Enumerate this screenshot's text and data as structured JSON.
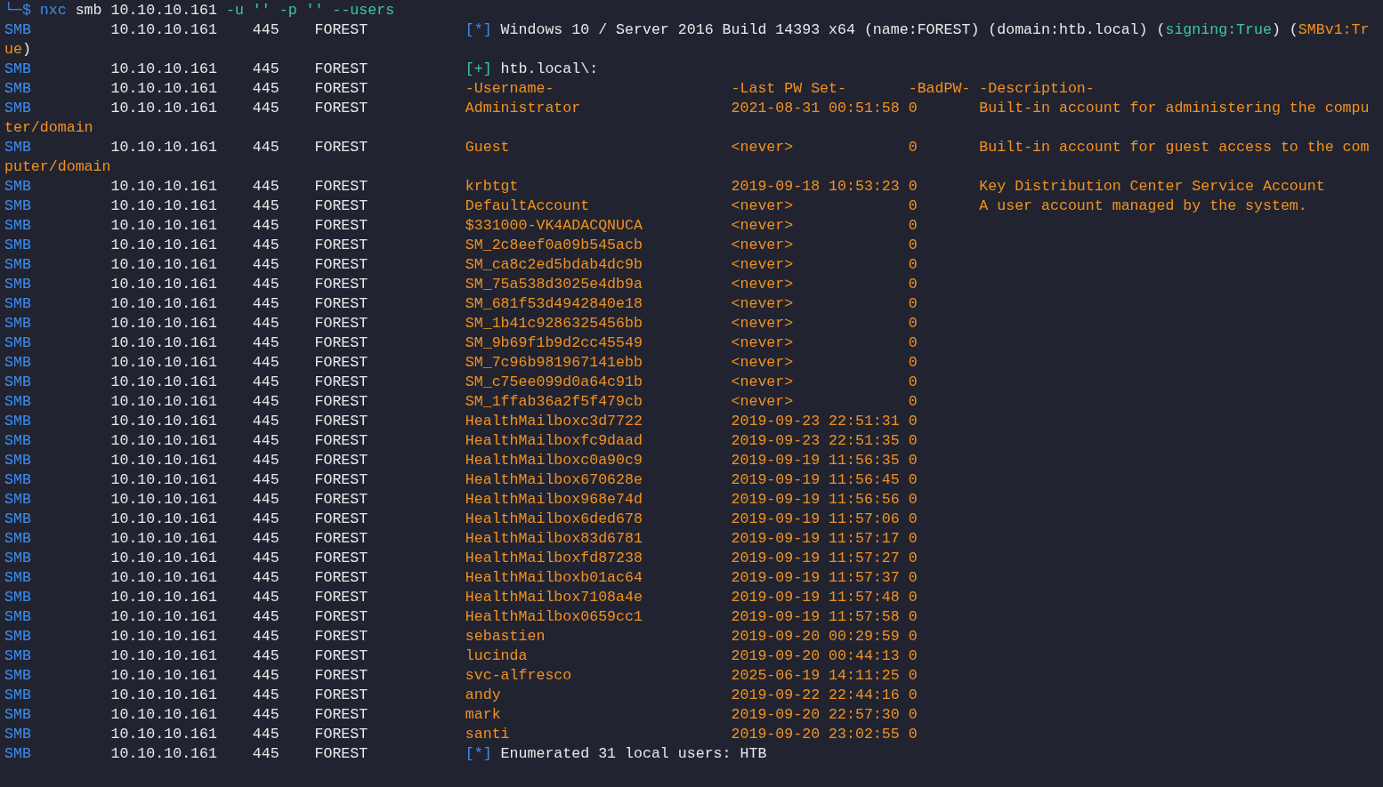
{
  "prompt": {
    "symbol": "└─$",
    "command": "nxc",
    "arguments": "smb 10.10.10.161",
    "options": "-u '' -p '' --users"
  },
  "lines": [
    {
      "kind": "smb",
      "protocol": "SMB",
      "host": "10.10.10.161",
      "port": "445",
      "name": "FOREST",
      "message": {
        "kind": "status",
        "marker": "[*]",
        "segments": [
          {
            "text": "Windows 10 / Server 2016 Build 14393 x64 (name:FOREST) (domain:htb.local) (",
            "kind": "plain"
          },
          {
            "text": "signing:True",
            "kind": "good"
          },
          {
            "text": ") (",
            "kind": "plain"
          },
          {
            "text": "SMBv1:Tr",
            "kind": "warn"
          }
        ]
      }
    },
    {
      "kind": "wrap",
      "segments": [
        {
          "text": "ue",
          "kind": "warn"
        },
        {
          "text": ")",
          "kind": "plain"
        }
      ]
    },
    {
      "kind": "smb",
      "protocol": "SMB",
      "host": "10.10.10.161",
      "port": "445",
      "name": "FOREST",
      "message": {
        "kind": "success",
        "marker": "[+]",
        "segments": [
          {
            "text": "htb.local\\:",
            "kind": "plain"
          }
        ]
      }
    },
    {
      "kind": "smb",
      "protocol": "SMB",
      "host": "10.10.10.161",
      "port": "445",
      "name": "FOREST",
      "message": {
        "kind": "header",
        "username": "-Username-",
        "last_pw_set": "-Last PW Set-",
        "bad_pw": "-BadPW-",
        "description": "-Description-"
      }
    },
    {
      "kind": "smb",
      "protocol": "SMB",
      "host": "10.10.10.161",
      "port": "445",
      "name": "FOREST",
      "message": {
        "kind": "user",
        "username": "Administrator",
        "last_pw_set": "2021-08-31 00:51:58",
        "bad_pw": "0",
        "description": "Built-in account for administering the compu"
      }
    },
    {
      "kind": "wrap",
      "segments": [
        {
          "text": "ter/domain",
          "kind": "warn"
        }
      ]
    },
    {
      "kind": "smb",
      "protocol": "SMB",
      "host": "10.10.10.161",
      "port": "445",
      "name": "FOREST",
      "message": {
        "kind": "user",
        "username": "Guest",
        "last_pw_set": "<never>",
        "bad_pw": "0",
        "description": "Built-in account for guest access to the com"
      }
    },
    {
      "kind": "wrap",
      "segments": [
        {
          "text": "puter/domain",
          "kind": "warn"
        }
      ]
    },
    {
      "kind": "smb",
      "protocol": "SMB",
      "host": "10.10.10.161",
      "port": "445",
      "name": "FOREST",
      "message": {
        "kind": "user",
        "username": "krbtgt",
        "last_pw_set": "2019-09-18 10:53:23",
        "bad_pw": "0",
        "description": "Key Distribution Center Service Account"
      }
    },
    {
      "kind": "smb",
      "protocol": "SMB",
      "host": "10.10.10.161",
      "port": "445",
      "name": "FOREST",
      "message": {
        "kind": "user",
        "username": "DefaultAccount",
        "last_pw_set": "<never>",
        "bad_pw": "0",
        "description": "A user account managed by the system."
      }
    },
    {
      "kind": "smb",
      "protocol": "SMB",
      "host": "10.10.10.161",
      "port": "445",
      "name": "FOREST",
      "message": {
        "kind": "user",
        "username": "$331000-VK4ADACQNUCA",
        "last_pw_set": "<never>",
        "bad_pw": "0"
      }
    },
    {
      "kind": "smb",
      "protocol": "SMB",
      "host": "10.10.10.161",
      "port": "445",
      "name": "FOREST",
      "message": {
        "kind": "user",
        "username": "SM_2c8eef0a09b545acb",
        "last_pw_set": "<never>",
        "bad_pw": "0"
      }
    },
    {
      "kind": "smb",
      "protocol": "SMB",
      "host": "10.10.10.161",
      "port": "445",
      "name": "FOREST",
      "message": {
        "kind": "user",
        "username": "SM_ca8c2ed5bdab4dc9b",
        "last_pw_set": "<never>",
        "bad_pw": "0"
      }
    },
    {
      "kind": "smb",
      "protocol": "SMB",
      "host": "10.10.10.161",
      "port": "445",
      "name": "FOREST",
      "message": {
        "kind": "user",
        "username": "SM_75a538d3025e4db9a",
        "last_pw_set": "<never>",
        "bad_pw": "0"
      }
    },
    {
      "kind": "smb",
      "protocol": "SMB",
      "host": "10.10.10.161",
      "port": "445",
      "name": "FOREST",
      "message": {
        "kind": "user",
        "username": "SM_681f53d4942840e18",
        "last_pw_set": "<never>",
        "bad_pw": "0"
      }
    },
    {
      "kind": "smb",
      "protocol": "SMB",
      "host": "10.10.10.161",
      "port": "445",
      "name": "FOREST",
      "message": {
        "kind": "user",
        "username": "SM_1b41c9286325456bb",
        "last_pw_set": "<never>",
        "bad_pw": "0"
      }
    },
    {
      "kind": "smb",
      "protocol": "SMB",
      "host": "10.10.10.161",
      "port": "445",
      "name": "FOREST",
      "message": {
        "kind": "user",
        "username": "SM_9b69f1b9d2cc45549",
        "last_pw_set": "<never>",
        "bad_pw": "0"
      }
    },
    {
      "kind": "smb",
      "protocol": "SMB",
      "host": "10.10.10.161",
      "port": "445",
      "name": "FOREST",
      "message": {
        "kind": "user",
        "username": "SM_7c96b981967141ebb",
        "last_pw_set": "<never>",
        "bad_pw": "0"
      }
    },
    {
      "kind": "smb",
      "protocol": "SMB",
      "host": "10.10.10.161",
      "port": "445",
      "name": "FOREST",
      "message": {
        "kind": "user",
        "username": "SM_c75ee099d0a64c91b",
        "last_pw_set": "<never>",
        "bad_pw": "0"
      }
    },
    {
      "kind": "smb",
      "protocol": "SMB",
      "host": "10.10.10.161",
      "port": "445",
      "name": "FOREST",
      "message": {
        "kind": "user",
        "username": "SM_1ffab36a2f5f479cb",
        "last_pw_set": "<never>",
        "bad_pw": "0"
      }
    },
    {
      "kind": "smb",
      "protocol": "SMB",
      "host": "10.10.10.161",
      "port": "445",
      "name": "FOREST",
      "message": {
        "kind": "user",
        "username": "HealthMailboxc3d7722",
        "last_pw_set": "2019-09-23 22:51:31",
        "bad_pw": "0"
      }
    },
    {
      "kind": "smb",
      "protocol": "SMB",
      "host": "10.10.10.161",
      "port": "445",
      "name": "FOREST",
      "message": {
        "kind": "user",
        "username": "HealthMailboxfc9daad",
        "last_pw_set": "2019-09-23 22:51:35",
        "bad_pw": "0"
      }
    },
    {
      "kind": "smb",
      "protocol": "SMB",
      "host": "10.10.10.161",
      "port": "445",
      "name": "FOREST",
      "message": {
        "kind": "user",
        "username": "HealthMailboxc0a90c9",
        "last_pw_set": "2019-09-19 11:56:35",
        "bad_pw": "0"
      }
    },
    {
      "kind": "smb",
      "protocol": "SMB",
      "host": "10.10.10.161",
      "port": "445",
      "name": "FOREST",
      "message": {
        "kind": "user",
        "username": "HealthMailbox670628e",
        "last_pw_set": "2019-09-19 11:56:45",
        "bad_pw": "0"
      }
    },
    {
      "kind": "smb",
      "protocol": "SMB",
      "host": "10.10.10.161",
      "port": "445",
      "name": "FOREST",
      "message": {
        "kind": "user",
        "username": "HealthMailbox968e74d",
        "last_pw_set": "2019-09-19 11:56:56",
        "bad_pw": "0"
      }
    },
    {
      "kind": "smb",
      "protocol": "SMB",
      "host": "10.10.10.161",
      "port": "445",
      "name": "FOREST",
      "message": {
        "kind": "user",
        "username": "HealthMailbox6ded678",
        "last_pw_set": "2019-09-19 11:57:06",
        "bad_pw": "0"
      }
    },
    {
      "kind": "smb",
      "protocol": "SMB",
      "host": "10.10.10.161",
      "port": "445",
      "name": "FOREST",
      "message": {
        "kind": "user",
        "username": "HealthMailbox83d6781",
        "last_pw_set": "2019-09-19 11:57:17",
        "bad_pw": "0"
      }
    },
    {
      "kind": "smb",
      "protocol": "SMB",
      "host": "10.10.10.161",
      "port": "445",
      "name": "FOREST",
      "message": {
        "kind": "user",
        "username": "HealthMailboxfd87238",
        "last_pw_set": "2019-09-19 11:57:27",
        "bad_pw": "0"
      }
    },
    {
      "kind": "smb",
      "protocol": "SMB",
      "host": "10.10.10.161",
      "port": "445",
      "name": "FOREST",
      "message": {
        "kind": "user",
        "username": "HealthMailboxb01ac64",
        "last_pw_set": "2019-09-19 11:57:37",
        "bad_pw": "0"
      }
    },
    {
      "kind": "smb",
      "protocol": "SMB",
      "host": "10.10.10.161",
      "port": "445",
      "name": "FOREST",
      "message": {
        "kind": "user",
        "username": "HealthMailbox7108a4e",
        "last_pw_set": "2019-09-19 11:57:48",
        "bad_pw": "0"
      }
    },
    {
      "kind": "smb",
      "protocol": "SMB",
      "host": "10.10.10.161",
      "port": "445",
      "name": "FOREST",
      "message": {
        "kind": "user",
        "username": "HealthMailbox0659cc1",
        "last_pw_set": "2019-09-19 11:57:58",
        "bad_pw": "0"
      }
    },
    {
      "kind": "smb",
      "protocol": "SMB",
      "host": "10.10.10.161",
      "port": "445",
      "name": "FOREST",
      "message": {
        "kind": "user",
        "username": "sebastien",
        "last_pw_set": "2019-09-20 00:29:59",
        "bad_pw": "0"
      }
    },
    {
      "kind": "smb",
      "protocol": "SMB",
      "host": "10.10.10.161",
      "port": "445",
      "name": "FOREST",
      "message": {
        "kind": "user",
        "username": "lucinda",
        "last_pw_set": "2019-09-20 00:44:13",
        "bad_pw": "0"
      }
    },
    {
      "kind": "smb",
      "protocol": "SMB",
      "host": "10.10.10.161",
      "port": "445",
      "name": "FOREST",
      "message": {
        "kind": "user",
        "username": "svc-alfresco",
        "last_pw_set": "2025-06-19 14:11:25",
        "bad_pw": "0"
      }
    },
    {
      "kind": "smb",
      "protocol": "SMB",
      "host": "10.10.10.161",
      "port": "445",
      "name": "FOREST",
      "message": {
        "kind": "user",
        "username": "andy",
        "last_pw_set": "2019-09-22 22:44:16",
        "bad_pw": "0"
      }
    },
    {
      "kind": "smb",
      "protocol": "SMB",
      "host": "10.10.10.161",
      "port": "445",
      "name": "FOREST",
      "message": {
        "kind": "user",
        "username": "mark",
        "last_pw_set": "2019-09-20 22:57:30",
        "bad_pw": "0"
      }
    },
    {
      "kind": "smb",
      "protocol": "SMB",
      "host": "10.10.10.161",
      "port": "445",
      "name": "FOREST",
      "message": {
        "kind": "user",
        "username": "santi",
        "last_pw_set": "2019-09-20 23:02:55",
        "bad_pw": "0"
      }
    },
    {
      "kind": "smb",
      "protocol": "SMB",
      "host": "10.10.10.161",
      "port": "445",
      "name": "FOREST",
      "message": {
        "kind": "status",
        "marker": "[*]",
        "segments": [
          {
            "text": "Enumerated 31 local users: HTB",
            "kind": "plain"
          }
        ]
      }
    }
  ]
}
